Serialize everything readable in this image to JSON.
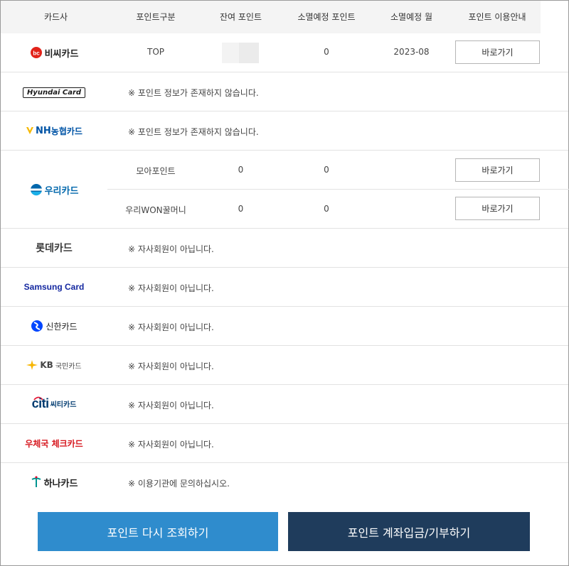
{
  "headers": [
    "카드사",
    "포인트구분",
    "잔여 포인트",
    "소멸예정 포인트",
    "소멸예정 월",
    "포인트 이용안내"
  ],
  "bc": {
    "logo": "비씨카드",
    "type": "TOP",
    "expiring": "0",
    "month": "2023-08",
    "button": "바로가기"
  },
  "hyundai": {
    "logo": "Hyundai Card",
    "message": "※ 포인트 정보가 존재하지 않습니다."
  },
  "nh": {
    "logo_nh": "NH",
    "logo_rest": "농협카드",
    "message": "※ 포인트 정보가 존재하지 않습니다."
  },
  "woori": {
    "logo": "우리카드",
    "rows": [
      {
        "type": "모아포인트",
        "balance": "0",
        "expiring": "0",
        "button": "바로가기"
      },
      {
        "type": "우리WON꿀머니",
        "balance": "0",
        "expiring": "0",
        "button": "바로가기"
      }
    ]
  },
  "lotte": {
    "logo": "롯데카드",
    "message": "※ 자사회원이 아닙니다."
  },
  "samsung": {
    "logo": "Samsung Card",
    "message": "※ 자사회원이 아닙니다."
  },
  "shinhan": {
    "logo": "신한카드",
    "message": "※ 자사회원이 아닙니다."
  },
  "kb": {
    "logo_kb": "KB",
    "logo_rest": "국민카드",
    "message": "※ 자사회원이 아닙니다."
  },
  "citi": {
    "logo_citi": "citi",
    "logo_rest": "씨티카드",
    "message": "※ 자사회원이 아닙니다."
  },
  "post": {
    "logo": "우체국 체크카드",
    "message": "※ 자사회원이 아닙니다."
  },
  "hana": {
    "logo": "하나카드",
    "message": "※ 이용기관에 문의하십시오."
  },
  "actions": {
    "refresh": "포인트 다시 조회하기",
    "transfer": "포인트 계좌입금/기부하기"
  },
  "colors": {
    "primary": "#2f8ccd",
    "secondary": "#1f3c5c",
    "bc_red": "#e2231a",
    "hyundai": "#1a1a1a",
    "nh_blue": "#0054a6",
    "woori_blue": "#0067ac",
    "samsung_blue": "#1428a0",
    "kb_yellow": "#f7b500",
    "citi_blue": "#003b70",
    "post_red": "#d71920",
    "hana_green": "#009490"
  }
}
